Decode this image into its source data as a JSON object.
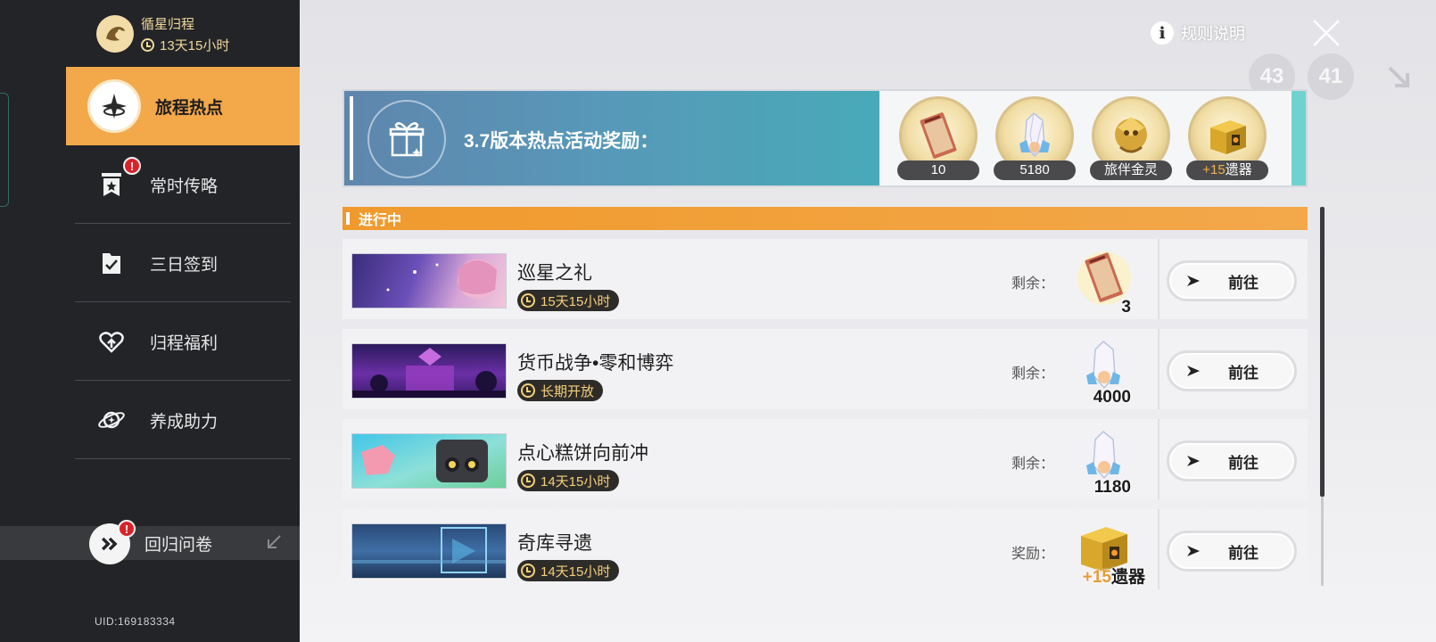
{
  "sidebar": {
    "event_name": "循星归程",
    "event_timer": "13天15小时",
    "items": [
      {
        "label": "旅程热点",
        "active": true,
        "badge": ""
      },
      {
        "label": "常时传略",
        "active": false,
        "badge": "!"
      },
      {
        "label": "三日签到",
        "active": false,
        "badge": ""
      },
      {
        "label": "归程福利",
        "active": false,
        "badge": ""
      },
      {
        "label": "养成助力",
        "active": false,
        "badge": ""
      }
    ],
    "survey": {
      "label": "回归问卷",
      "badge": "!"
    },
    "uid": "UID:169183334"
  },
  "header": {
    "rules_label": "规则说明",
    "info_glyph": "i",
    "ghost_a": "43",
    "ghost_b": "41"
  },
  "banner": {
    "title": "3.7版本热点活动奖励：",
    "rewards": [
      {
        "icon": "ticket-icon",
        "label": "10"
      },
      {
        "icon": "crystal-icon",
        "label": "5180"
      },
      {
        "icon": "companion-icon",
        "label": "旅伴金灵"
      },
      {
        "icon": "relic-chest-icon",
        "plus": "+15",
        "label": "遗器"
      }
    ]
  },
  "list": {
    "header": "进行中",
    "rows": [
      {
        "title": "巡星之礼",
        "timer": "15天15小时",
        "remain_label": "剩余：",
        "reward_icon": "ticket-icon",
        "count": "3",
        "count_plus": "",
        "button": "前往"
      },
      {
        "title": "货币战争•零和博弈",
        "timer": "长期开放",
        "remain_label": "剩余：",
        "reward_icon": "crystal-icon",
        "count": "4000",
        "count_plus": "",
        "button": "前往"
      },
      {
        "title": "点心糕饼向前冲",
        "timer": "14天15小时",
        "remain_label": "剩余：",
        "reward_icon": "crystal-icon",
        "count": "1180",
        "count_plus": "",
        "button": "前往"
      },
      {
        "title": "奇库寻遗",
        "timer": "14天15小时",
        "remain_label": "奖励：",
        "reward_icon": "relic-chest-icon",
        "count": "遗器",
        "count_plus": "+15",
        "button": "前往"
      }
    ]
  },
  "colors": {
    "accent_orange": "#f3a84a",
    "sidebar_bg": "#232428",
    "banner_blue": "#5897b8",
    "badge_red": "#d8232a"
  }
}
